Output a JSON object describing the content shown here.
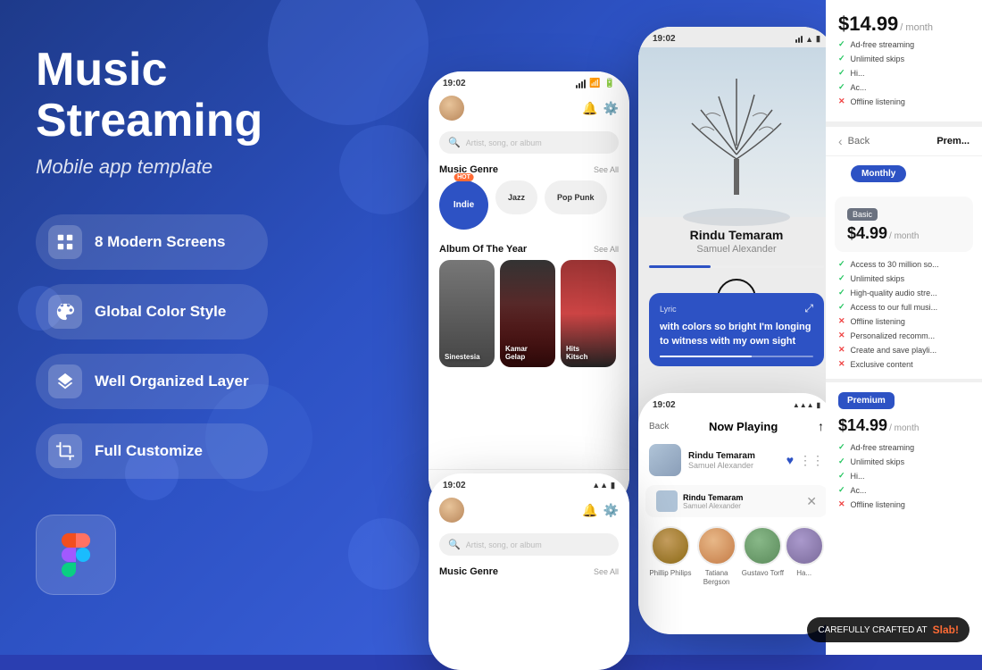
{
  "page": {
    "background_color": "#2a3eb1"
  },
  "left": {
    "title_line1": "Music",
    "title_line2": "Streaming",
    "subtitle": "Mobile app template",
    "features": [
      {
        "id": "screens",
        "label": "8 Modern Screens",
        "icon": "grid-icon"
      },
      {
        "id": "color",
        "label": "Global Color Style",
        "icon": "palette-icon"
      },
      {
        "id": "layer",
        "label": "Well Organized Layer",
        "icon": "layers-icon"
      },
      {
        "id": "customize",
        "label": "Full Customize",
        "icon": "crop-icon"
      }
    ],
    "figma_badge_alt": "Figma"
  },
  "phone1": {
    "status_time": "19:02",
    "search_placeholder": "Artist, song, or album",
    "genre_section": "Music Genre",
    "see_all": "See All",
    "hot_tag": "HOT",
    "genres": [
      {
        "name": "Indie",
        "hot": true
      },
      {
        "name": "Jazz",
        "hot": false
      },
      {
        "name": "Pop Punk",
        "hot": false
      }
    ],
    "album_section": "Album Of The Year",
    "albums": [
      {
        "name": "Sinestesia",
        "color1": "#555",
        "color2": "#888"
      },
      {
        "name": "Kamar\nGelap",
        "color1": "#8b1a1a",
        "color2": "#444"
      },
      {
        "name": "Hits\nKitsch",
        "color1": "#cc3333",
        "color2": "#993333"
      }
    ]
  },
  "phone2": {
    "status_time": "19:02",
    "song_title": "Rindu Temaram",
    "song_artist": "Samuel Alexander",
    "lyric_label": "Lyric",
    "lyric_text": "with colors so bright I'm longing to witness with my own sight"
  },
  "phone3": {
    "status_time": "19:02",
    "back_label": "Back",
    "now_playing": "Now Playing",
    "song_title": "Rindu Temaram",
    "song_artist": "Samuel Alexander",
    "people": [
      {
        "name": "Phillip Philips",
        "color": "#8b6914"
      },
      {
        "name": "Tatiana Bergson",
        "color": "#c47a45"
      },
      {
        "name": "Gustavo Torff",
        "color": "#5a8a5a"
      },
      {
        "name": "Ha...",
        "color": "#7a6a9a"
      }
    ]
  },
  "pricing": {
    "back_label": "Back",
    "prem_label": "Prem...",
    "monthly_tab": "Monthly",
    "basic_label": "Basic",
    "basic_price": "$4.99",
    "basic_period": "/ month",
    "basic_features": [
      {
        "text": "Access to 30 million so...",
        "check": true
      },
      {
        "text": "Unlimited skips",
        "check": true
      },
      {
        "text": "High-quality audio stre...",
        "check": true
      },
      {
        "text": "Access to our full musi...",
        "check": true
      },
      {
        "text": "Offline listening",
        "check": false
      },
      {
        "text": "Personalized recomm...",
        "check": false
      },
      {
        "text": "Create and save playli...",
        "check": false
      },
      {
        "text": "Exclusive content",
        "check": false
      }
    ],
    "premium_label": "Premium",
    "premium_price": "$14.99",
    "premium_period": "/ month",
    "premium_features_top": [
      {
        "text": "Ad-free streaming",
        "check": true
      },
      {
        "text": "Unlimited skips",
        "check": true
      },
      {
        "text": "Hi...",
        "check": true
      },
      {
        "text": "Ac...",
        "check": true
      },
      {
        "text": "Offline listening",
        "check": false
      }
    ],
    "top_price": "$14.99",
    "top_period": "/ month",
    "top_features": [
      {
        "text": "Ad-free streaming",
        "check": true
      },
      {
        "text": "Unlimited skips",
        "check": true
      },
      {
        "text": "Hi...",
        "check": true
      },
      {
        "text": "Ac...",
        "check": true
      },
      {
        "text": "Offline listening",
        "check": false
      }
    ]
  },
  "crafted_badge": {
    "text": "CAREFULLY CRAFTED AT",
    "brand": "Slab!"
  }
}
